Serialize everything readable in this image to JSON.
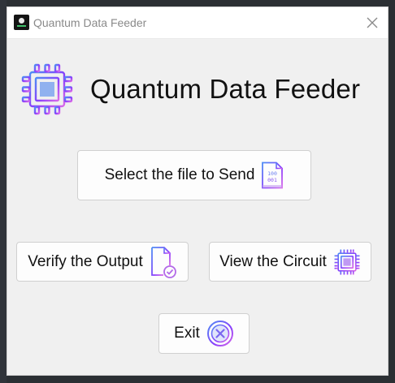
{
  "window": {
    "title": "Quantum Data Feeder"
  },
  "header": {
    "title": "Quantum Data Feeder",
    "icon": "chip-icon"
  },
  "buttons": {
    "send": {
      "label": "Select the file to Send",
      "icon": "binary-file-icon"
    },
    "verify": {
      "label": "Verify the Output",
      "icon": "document-check-icon"
    },
    "view": {
      "label": "View the Circuit",
      "icon": "chip-icon"
    },
    "exit": {
      "label": "Exit",
      "icon": "close-circle-icon"
    }
  },
  "colors": {
    "accent_purple": "#8a3ffc",
    "accent_blue": "#4f8df5",
    "accent_pink": "#d96ae8",
    "window_bg": "#f0f0f0"
  }
}
